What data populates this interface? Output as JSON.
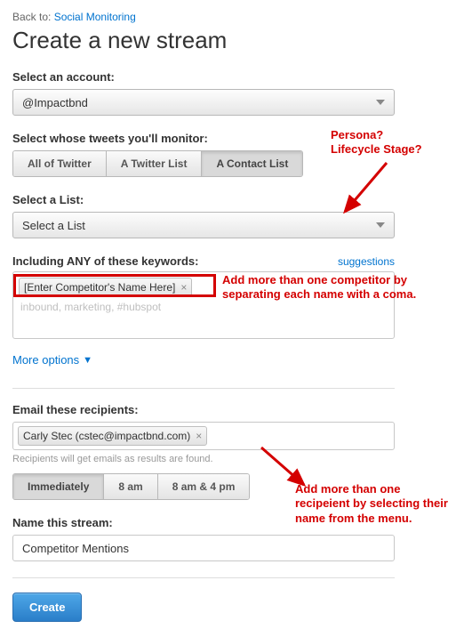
{
  "back": {
    "prefix": "Back to:",
    "link": "Social Monitoring"
  },
  "title": "Create a new stream",
  "account": {
    "label": "Select an account:",
    "value": "@Impactbnd"
  },
  "monitor": {
    "label": "Select whose tweets you'll monitor:",
    "options": [
      "All of Twitter",
      "A Twitter List",
      "A Contact List"
    ]
  },
  "list": {
    "label": "Select a List:",
    "value": "Select a List"
  },
  "keywords": {
    "label": "Including ANY of these keywords:",
    "suggestions": "suggestions",
    "tag": "[Enter Competitor's Name Here]",
    "placeholder": "inbound, marketing, #hubspot"
  },
  "more_options": "More options",
  "recipients": {
    "label": "Email these recipients:",
    "tag": "Carly Stec (cstec@impactbnd.com)",
    "helper": "Recipients will get emails as results are found."
  },
  "timing": {
    "options": [
      "Immediately",
      "8 am",
      "8 am & 4 pm"
    ]
  },
  "stream_name": {
    "label": "Name this stream:",
    "value": "Competitor Mentions"
  },
  "create": "Create",
  "annotations": {
    "persona": "Persona?\nLifecycle Stage?",
    "keywords_more": "Add more than one competitor by separating each name with a coma.",
    "recipients_more": "Add more than one recipeient by selecting their name from the menu."
  }
}
